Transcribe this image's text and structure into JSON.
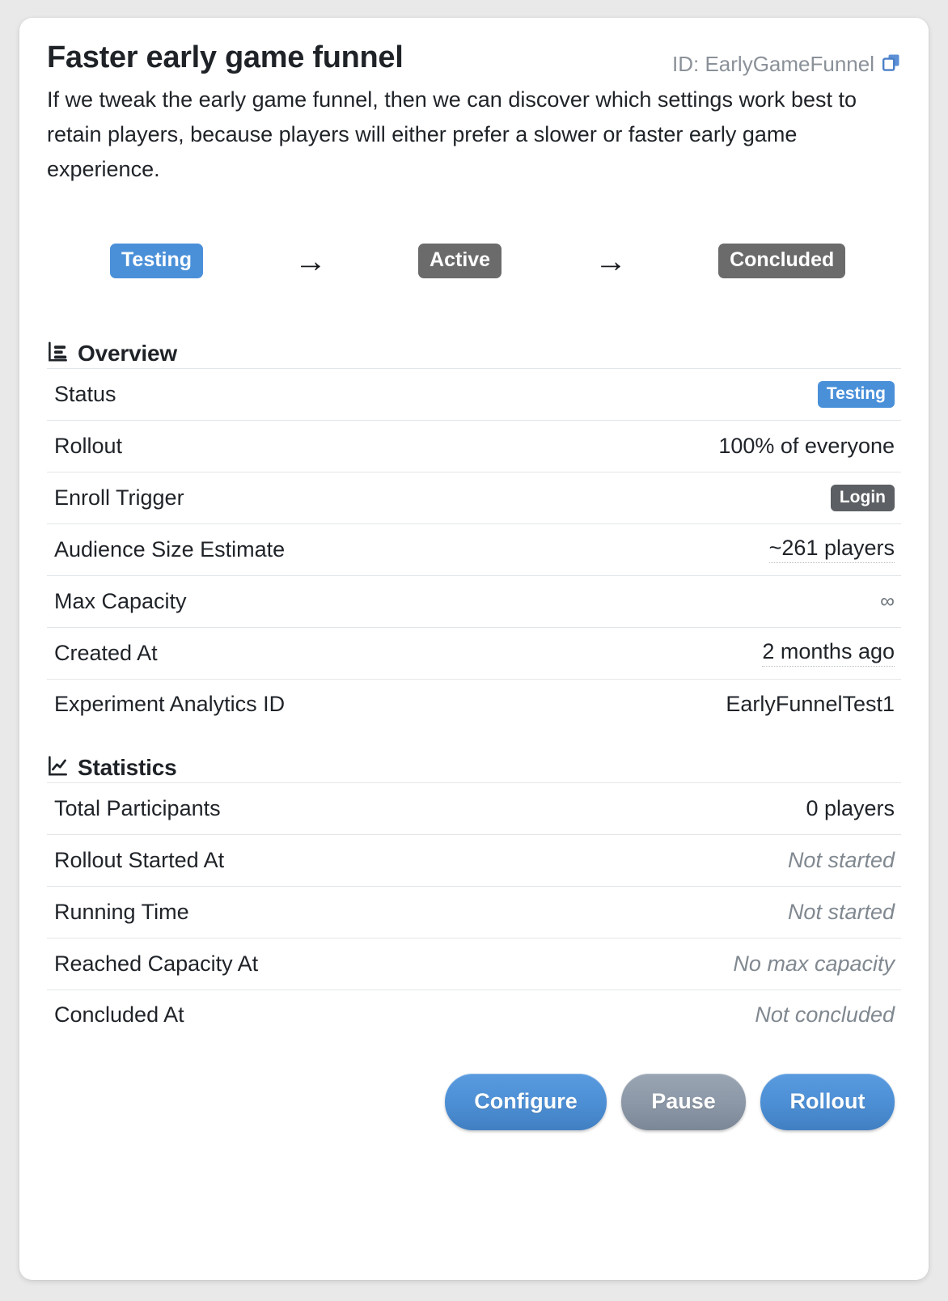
{
  "header": {
    "title": "Faster early game funnel",
    "id_label": "ID: EarlyGameFunnel",
    "copy_icon": "copy-icon",
    "description": "If we tweak the early game funnel, then we can discover which settings work best to retain players, because players will either prefer a slower or faster early game experience."
  },
  "flow": {
    "steps": [
      {
        "label": "Testing",
        "state": "active"
      },
      {
        "label": "Active",
        "state": "inactive"
      },
      {
        "label": "Concluded",
        "state": "inactive"
      }
    ],
    "arrow": "→",
    "colors": {
      "active": "#4a90d9",
      "inactive": "#6b6b6b"
    }
  },
  "overview": {
    "section_title": "Overview",
    "icon": "bar-chart-icon",
    "rows": [
      {
        "label": "Status",
        "value": "Testing",
        "kind": "pill-blue"
      },
      {
        "label": "Rollout",
        "value": "100% of everyone",
        "kind": "text"
      },
      {
        "label": "Enroll Trigger",
        "value": "Login",
        "kind": "pill-gray"
      },
      {
        "label": "Audience Size Estimate",
        "value": "~261 players",
        "kind": "dotted"
      },
      {
        "label": "Max Capacity",
        "value": "∞",
        "kind": "infinity"
      },
      {
        "label": "Created At",
        "value": "2 months ago",
        "kind": "dotted"
      },
      {
        "label": "Experiment Analytics ID",
        "value": "EarlyFunnelTest1",
        "kind": "text"
      }
    ]
  },
  "statistics": {
    "section_title": "Statistics",
    "icon": "line-chart-icon",
    "rows": [
      {
        "label": "Total Participants",
        "value": "0 players",
        "kind": "text"
      },
      {
        "label": "Rollout Started At",
        "value": "Not started",
        "kind": "muted-italic"
      },
      {
        "label": "Running Time",
        "value": "Not started",
        "kind": "muted-italic"
      },
      {
        "label": "Reached Capacity At",
        "value": "No max capacity",
        "kind": "muted-italic"
      },
      {
        "label": "Concluded At",
        "value": "Not concluded",
        "kind": "muted-italic"
      }
    ]
  },
  "footer": {
    "configure_label": "Configure",
    "pause_label": "Pause",
    "rollout_label": "Rollout",
    "primary_color": "#4a90d9",
    "secondary_color": "#8b97a6"
  }
}
